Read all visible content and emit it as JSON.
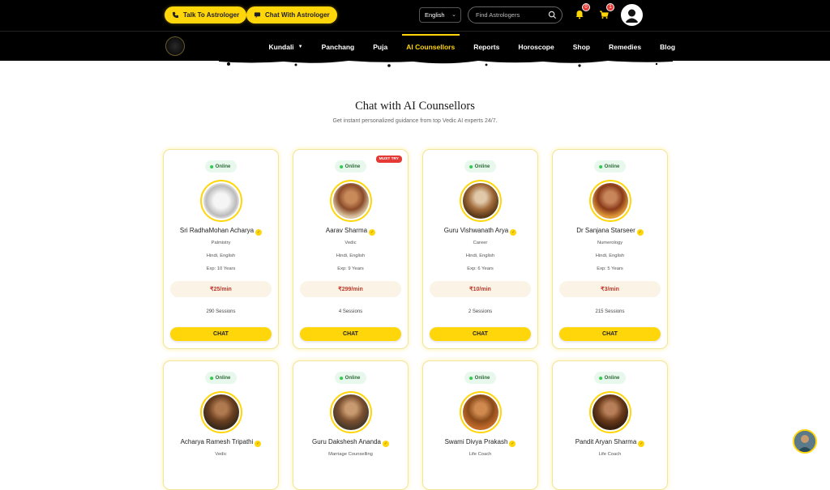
{
  "header": {
    "talk_label": "Talk To Astrologer",
    "chat_label": "Chat With Astrologer",
    "language": "English",
    "search_placeholder": "Find Astrologers",
    "notif_count": "0",
    "cart_count": "1"
  },
  "nav": {
    "items": [
      "Kundali",
      "Panchang",
      "Puja",
      "AI Counsellors",
      "Reports",
      "Horoscope",
      "Shop",
      "Remedies",
      "Blog"
    ],
    "active": "AI Counsellors"
  },
  "section": {
    "title": "Chat with AI Counsellors",
    "subtitle": "Get instant personalized guidance from top Vedic AI experts 24/7."
  },
  "counsellors": [
    {
      "status": "Online",
      "name": "Sri RadhaMohan Acharya",
      "skill": "Palmistry",
      "languages": "Hindi, English",
      "exp": "Exp: 10 Years",
      "price": "₹25/min",
      "sessions": "290 Sessions",
      "cta": "CHAT",
      "tag": ""
    },
    {
      "status": "Online",
      "name": "Aarav Sharma",
      "skill": "Vedic",
      "languages": "Hindi, English",
      "exp": "Exp: 9 Years",
      "price": "₹299/min",
      "sessions": "4 Sessions",
      "cta": "CHAT",
      "tag": "MUST TRY"
    },
    {
      "status": "Online",
      "name": "Guru Vishwanath Arya",
      "skill": "Career",
      "languages": "Hindi, English",
      "exp": "Exp: 6 Years",
      "price": "₹10/min",
      "sessions": "2 Sessions",
      "cta": "CHAT",
      "tag": ""
    },
    {
      "status": "Online",
      "name": "Dr Sanjana Starseer",
      "skill": "Numerology",
      "languages": "Hindi, English",
      "exp": "Exp: 5 Years",
      "price": "₹3/min",
      "sessions": "215 Sessions",
      "cta": "CHAT",
      "tag": ""
    },
    {
      "status": "Online",
      "name": "Acharya Ramesh Tripathi",
      "skill": "Vedic",
      "languages": "",
      "exp": "",
      "price": "",
      "sessions": "",
      "cta": "",
      "tag": ""
    },
    {
      "status": "Online",
      "name": "Guru Dakshesh Ananda",
      "skill": "Marriage Counselling",
      "languages": "",
      "exp": "",
      "price": "",
      "sessions": "",
      "cta": "",
      "tag": ""
    },
    {
      "status": "Online",
      "name": "Swami Divya Prakash",
      "skill": "Life Coach",
      "languages": "",
      "exp": "",
      "price": "",
      "sessions": "",
      "cta": "",
      "tag": ""
    },
    {
      "status": "Online",
      "name": "Pandit Aryan Sharma",
      "skill": "Life Coach",
      "languages": "",
      "exp": "",
      "price": "",
      "sessions": "",
      "cta": "",
      "tag": ""
    }
  ],
  "colors": {
    "accent": "#ffd60a",
    "header_bg": "#000000",
    "price": "#c0392b",
    "online": "#2ecc51"
  }
}
